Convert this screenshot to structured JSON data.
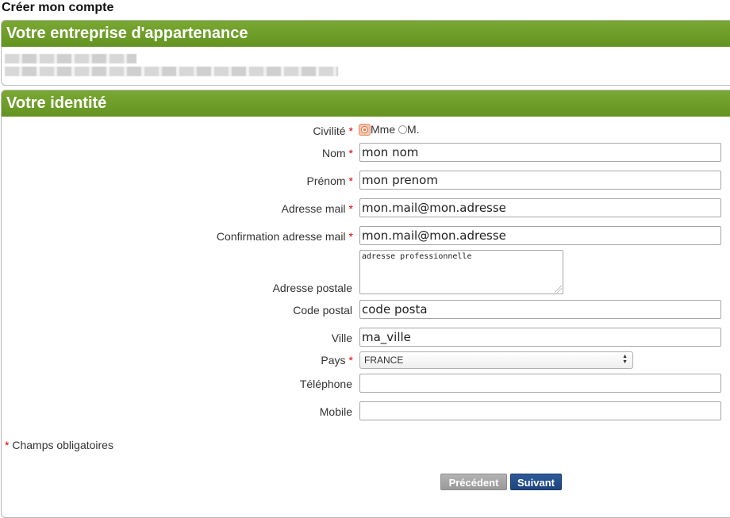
{
  "page": {
    "title": "Créer mon compte"
  },
  "company_section": {
    "title": "Votre entreprise d'appartenance"
  },
  "identity_section": {
    "title": "Votre identité",
    "civility": {
      "label": "Civilité",
      "options": [
        "Mme",
        "M."
      ],
      "selected": "Mme"
    },
    "fields": {
      "nom": {
        "label": "Nom",
        "value": "mon nom"
      },
      "prenom": {
        "label": "Prénom",
        "value": "mon prenom"
      },
      "email": {
        "label": "Adresse mail",
        "value": "mon.mail@mon.adresse"
      },
      "email_confirm": {
        "label": "Confirmation adresse mail",
        "value": "mon.mail@mon.adresse"
      },
      "adresse": {
        "label": "Adresse postale",
        "value": "adresse professionnelle"
      },
      "code_postal": {
        "label": "Code postal",
        "value": "code posta"
      },
      "ville": {
        "label": "Ville",
        "value": "ma_ville"
      },
      "pays": {
        "label": "Pays",
        "value": "FRANCE"
      },
      "telephone": {
        "label": "Téléphone",
        "value": ""
      },
      "mobile": {
        "label": "Mobile",
        "value": ""
      }
    },
    "required_marker": "*",
    "required_note": "Champs obligatoires"
  },
  "buttons": {
    "previous": "Précédent",
    "next": "Suivant"
  },
  "colors": {
    "header_green": "#6f9c2a",
    "next_blue": "#1e447c",
    "prev_gray": "#a6a6a6",
    "required_red": "#dd0000"
  }
}
